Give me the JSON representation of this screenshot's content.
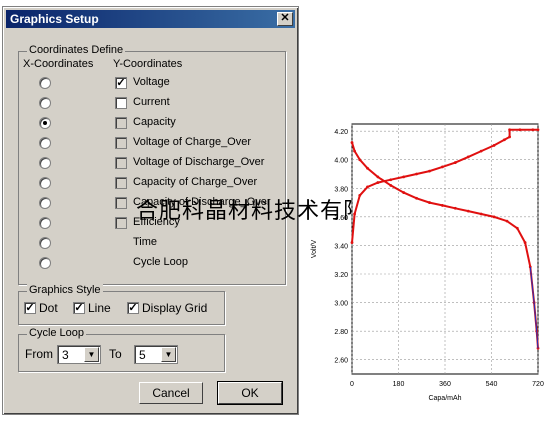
{
  "dialog": {
    "title": "Graphics Setup",
    "close_glyph": "✕",
    "coordinates": {
      "group_label": "Coordinates Define",
      "x_header": "X-Coordinates",
      "y_header": "Y-Coordinates",
      "rows": [
        {
          "label": "Voltage",
          "x_selected": false,
          "y_checked": true,
          "y_enabled": true
        },
        {
          "label": "Current",
          "x_selected": false,
          "y_checked": false,
          "y_enabled": true
        },
        {
          "label": "Capacity",
          "x_selected": true,
          "y_checked": false,
          "y_enabled": false
        },
        {
          "label": "Voltage of Charge_Over",
          "x_selected": false,
          "y_checked": false,
          "y_enabled": false
        },
        {
          "label": "Voltage of Discharge_Over",
          "x_selected": false,
          "y_checked": false,
          "y_enabled": false
        },
        {
          "label": "Capacity of Charge_Over",
          "x_selected": false,
          "y_checked": false,
          "y_enabled": false
        },
        {
          "label": "Capacity of Discharge_Over",
          "x_selected": false,
          "y_checked": false,
          "y_enabled": false
        },
        {
          "label": "Efficiency",
          "x_selected": false,
          "y_checked": false,
          "y_enabled": false
        },
        {
          "label": "Time",
          "x_selected": false
        },
        {
          "label": "Cycle Loop",
          "x_selected": false
        }
      ]
    },
    "graphics_style": {
      "group_label": "Graphics Style",
      "dot": {
        "label": "Dot",
        "checked": true
      },
      "line": {
        "label": "Line",
        "checked": true
      },
      "grid": {
        "label": "Display Grid",
        "checked": true
      }
    },
    "cycle_loop": {
      "group_label": "Cycle Loop",
      "from_label": "From",
      "from_value": "3",
      "to_label": "To",
      "to_value": "5"
    },
    "cancel_label": "Cancel",
    "ok_label": "OK",
    "check_glyph": "✓",
    "dropdown_glyph": "▼"
  },
  "watermark": "合肥科晶材料技术有限公司",
  "chart_data": {
    "type": "line",
    "ylabel": "Volt/V",
    "xlabel": "Capa/mAh",
    "xlim": [
      0,
      720
    ],
    "ylim": [
      2.5,
      4.25
    ],
    "x_ticks": [
      "0",
      "180",
      "360",
      "540",
      "720"
    ],
    "y_ticks": [
      "2.60",
      "2.80",
      "3.00",
      "3.20",
      "3.40",
      "3.60",
      "3.80",
      "4.00",
      "4.20"
    ],
    "grid": true,
    "colors": {
      "charge": "#e01010",
      "discharge": "#e01010",
      "blue_trace": "#2030c0"
    },
    "series": [
      {
        "key": "charge",
        "x": [
          0,
          10,
          30,
          60,
          100,
          150,
          200,
          250,
          300,
          350,
          400,
          450,
          500,
          550,
          590,
          610,
          610,
          650,
          700,
          720
        ],
        "y": [
          3.42,
          3.62,
          3.75,
          3.81,
          3.84,
          3.86,
          3.88,
          3.9,
          3.92,
          3.95,
          3.98,
          4.02,
          4.06,
          4.1,
          4.14,
          4.16,
          4.21,
          4.21,
          4.21,
          4.21
        ]
      },
      {
        "key": "discharge",
        "x": [
          0,
          10,
          30,
          60,
          100,
          150,
          200,
          250,
          300,
          350,
          400,
          450,
          500,
          550,
          600,
          640,
          670,
          690,
          705,
          715,
          720
        ],
        "y": [
          4.12,
          4.06,
          4.0,
          3.94,
          3.88,
          3.82,
          3.77,
          3.73,
          3.7,
          3.68,
          3.66,
          3.64,
          3.62,
          3.6,
          3.57,
          3.52,
          3.42,
          3.25,
          3.0,
          2.8,
          2.68
        ]
      }
    ]
  }
}
